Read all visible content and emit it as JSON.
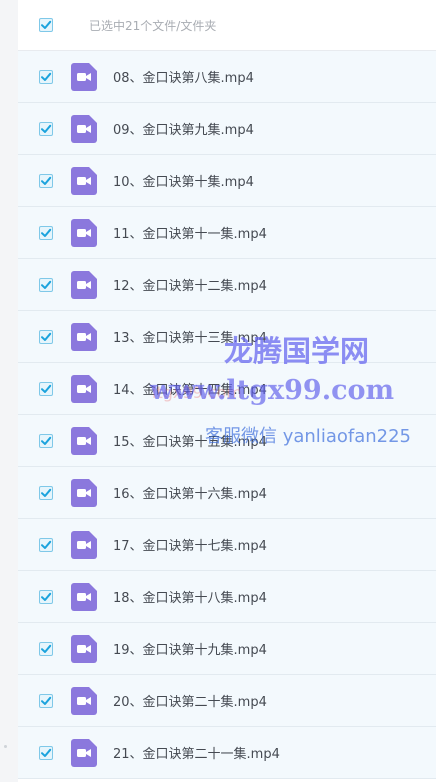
{
  "header": {
    "selection_text": "已选中21个文件/文件夹"
  },
  "files": [
    {
      "name": "08、金口诀第八集.mp4"
    },
    {
      "name": "09、金口诀第九集.mp4"
    },
    {
      "name": "10、金口诀第十集.mp4"
    },
    {
      "name": "11、金口诀第十一集.mp4"
    },
    {
      "name": "12、金口诀第十二集.mp4"
    },
    {
      "name": "13、金口诀第十三集.mp4"
    },
    {
      "name": "14、金口诀第十四集.mp4"
    },
    {
      "name": "15、金口诀第十五集.mp4"
    },
    {
      "name": "16、金口诀第十六集.mp4"
    },
    {
      "name": "17、金口诀第十七集.mp4"
    },
    {
      "name": "18、金口诀第十八集.mp4"
    },
    {
      "name": "19、金口诀第十九集.mp4"
    },
    {
      "name": "20、金口诀第二十集.mp4"
    },
    {
      "name": "21、金口诀第二十一集.mp4"
    }
  ],
  "watermark": {
    "title": "龙腾国学网",
    "url": "www.ltgx99.com",
    "contact": "客服微信 yanliaofan225",
    "faint": "ltgx99.com"
  },
  "colors": {
    "checkbox_tick": "#1ba3dd",
    "video_icon": "#8b78dd",
    "row_bg": "#f3f9fd"
  }
}
